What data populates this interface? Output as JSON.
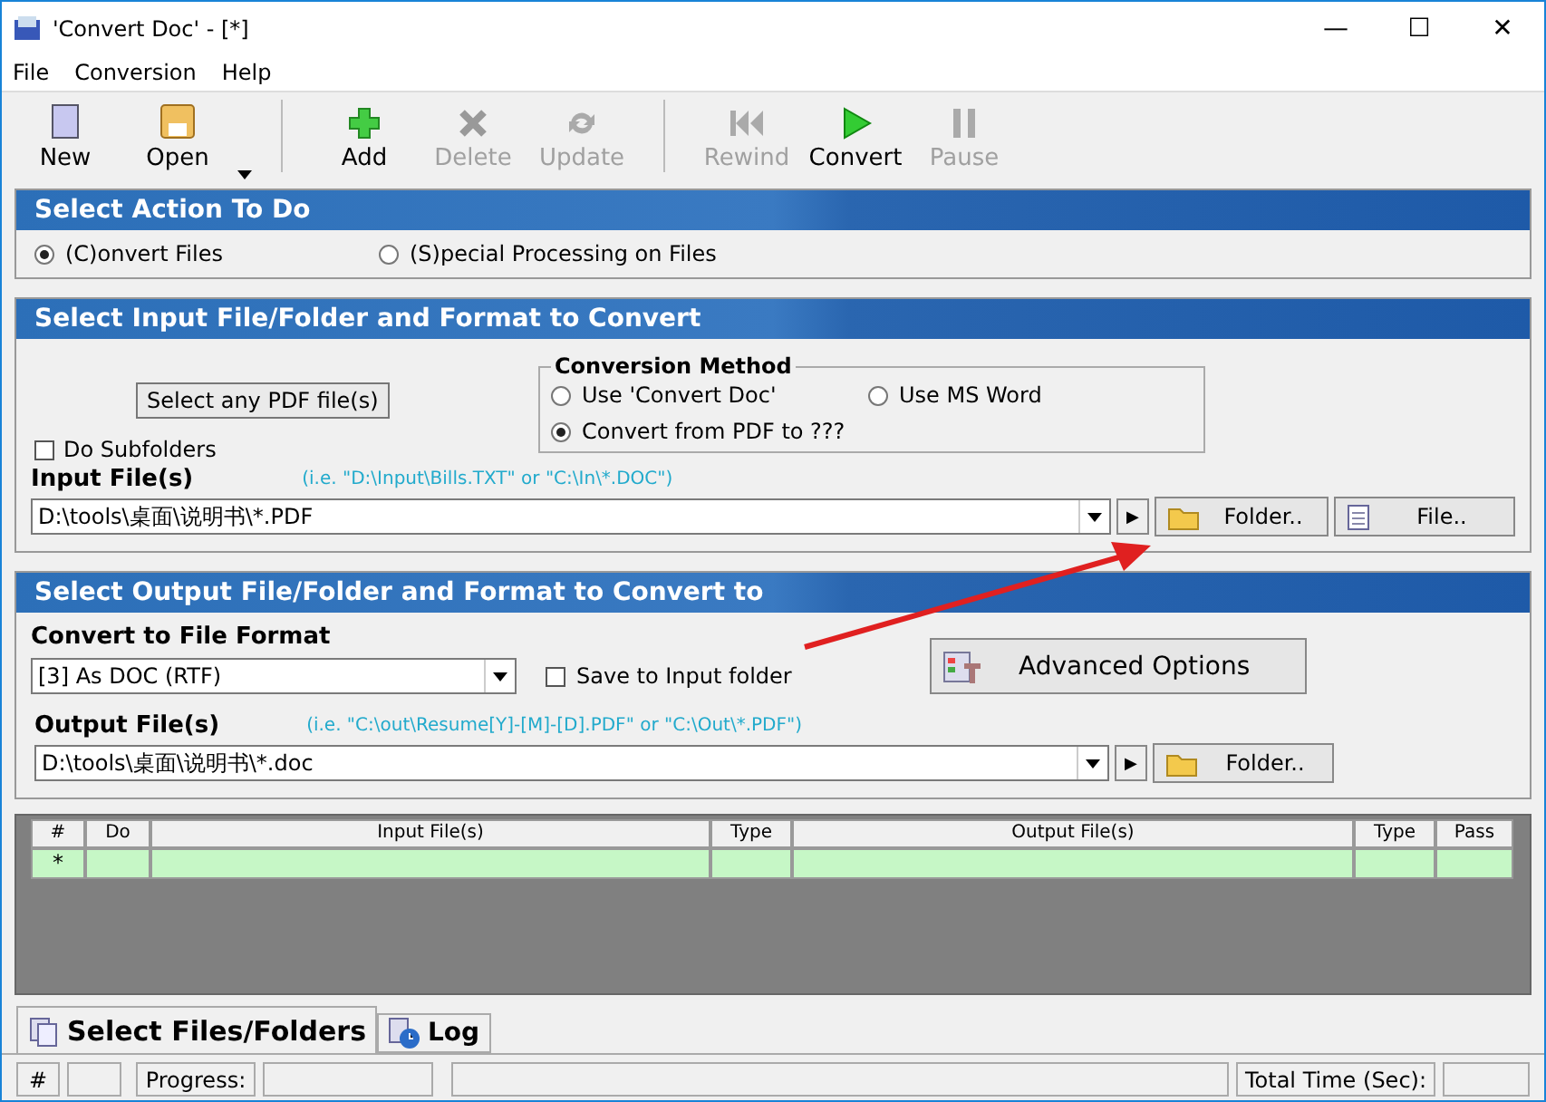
{
  "window": {
    "title": "'Convert Doc' - [*]",
    "controls": [
      "—",
      "☐",
      "✕"
    ]
  },
  "menu": [
    "File",
    "Conversion",
    "Help"
  ],
  "toolbar": [
    {
      "label": "New",
      "kind": "new",
      "disabled": false
    },
    {
      "label": "Open",
      "kind": "open",
      "disabled": false
    },
    {
      "label": "Add",
      "kind": "add",
      "disabled": false
    },
    {
      "label": "Delete",
      "kind": "delete",
      "disabled": true
    },
    {
      "label": "Update",
      "kind": "update",
      "disabled": true
    },
    {
      "label": "Rewind",
      "kind": "rewind",
      "disabled": true
    },
    {
      "label": "Convert",
      "kind": "convert",
      "disabled": false
    },
    {
      "label": "Pause",
      "kind": "pause",
      "disabled": true
    }
  ],
  "action": {
    "title": "Select Action To Do",
    "options": [
      {
        "label": "(C)onvert Files",
        "selected": true
      },
      {
        "label": "(S)pecial Processing on Files",
        "selected": false
      }
    ]
  },
  "input": {
    "title": "Select Input File/Folder and Format to Convert",
    "type_label": "Select any PDF file(s)",
    "do_subfolders": {
      "label": "Do Subfolders",
      "checked": false
    },
    "method": {
      "title": "Conversion Method",
      "options": [
        {
          "label": "Use 'Convert Doc'",
          "selected": false
        },
        {
          "label": "Use MS Word",
          "selected": false
        },
        {
          "label": "Convert from PDF to ???",
          "selected": true
        }
      ]
    },
    "files_label": "Input File(s)",
    "hint": "(i.e. \"D:\\Input\\Bills.TXT\"  or \"C:\\In\\*.DOC\")",
    "value": "D:\\tools\\桌面\\说明书\\*.PDF",
    "play": "▶",
    "folder_button": "Folder..",
    "file_button": "File.."
  },
  "output": {
    "title": "Select Output File/Folder and Format to Convert to",
    "format_label": "Convert to File Format",
    "format_value": "[3] As DOC (RTF)",
    "save_to_input": {
      "label": "Save to Input folder",
      "checked": false
    },
    "advanced_button": "Advanced Options",
    "files_label": "Output File(s)",
    "hint": "(i.e. \"C:\\out\\Resume[Y]-[M]-[D].PDF\" or \"C:\\Out\\*.PDF\")",
    "value": "D:\\tools\\桌面\\说明书\\*.doc",
    "play": "▶",
    "folder_button": "Folder.."
  },
  "table": {
    "columns": [
      "#",
      "Do",
      "Input File(s)",
      "Type",
      "Output File(s)",
      "Type",
      "Pass"
    ],
    "new_row_marker": "*"
  },
  "tabs": [
    {
      "label": "Select Files/Folders",
      "selected": true
    },
    {
      "label": "Log",
      "selected": false
    }
  ],
  "status_bar": {
    "hash": "#",
    "progress": "Progress:",
    "total_time": "Total Time (Sec):"
  }
}
